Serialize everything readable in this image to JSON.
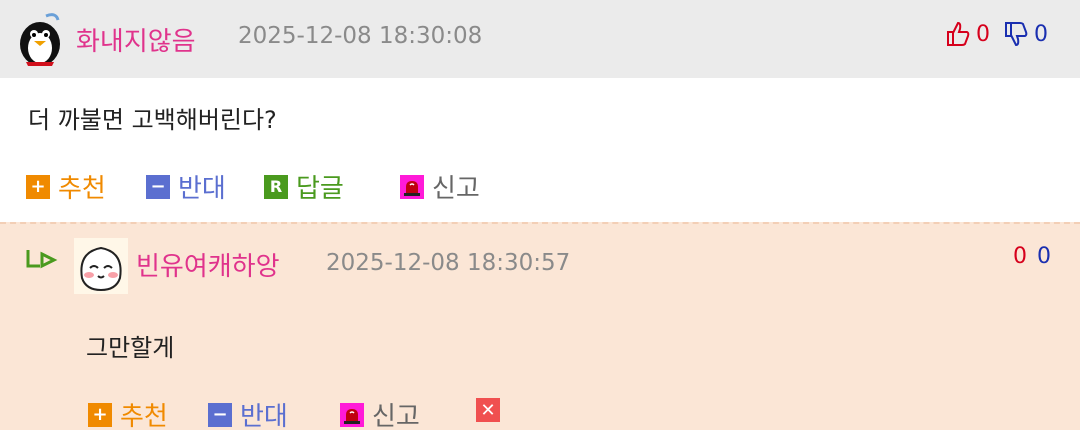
{
  "comment1": {
    "nickname": "화내지않음",
    "timestamp": "2025-12-08 18:30:08",
    "upvotes": "0",
    "downvotes": "0",
    "text": "더 까불면 고백해버린다?",
    "actions": {
      "recommend": "추천",
      "oppose": "반대",
      "reply": "답글",
      "report": "신고"
    }
  },
  "comment2": {
    "nickname": "빈유여캐하앙",
    "timestamp": "2025-12-08 18:30:57",
    "upvotes": "0",
    "downvotes": "0",
    "text": "그만할게",
    "actions": {
      "recommend": "추천",
      "oppose": "반대",
      "report": "신고"
    }
  },
  "colors": {
    "nickname": "#e0338c",
    "recommend": "#f08a00",
    "oppose": "#5b6fd0",
    "reply": "#4a9a1e",
    "report": "#666666",
    "up": "#d6001c",
    "down": "#1a2fb0"
  }
}
